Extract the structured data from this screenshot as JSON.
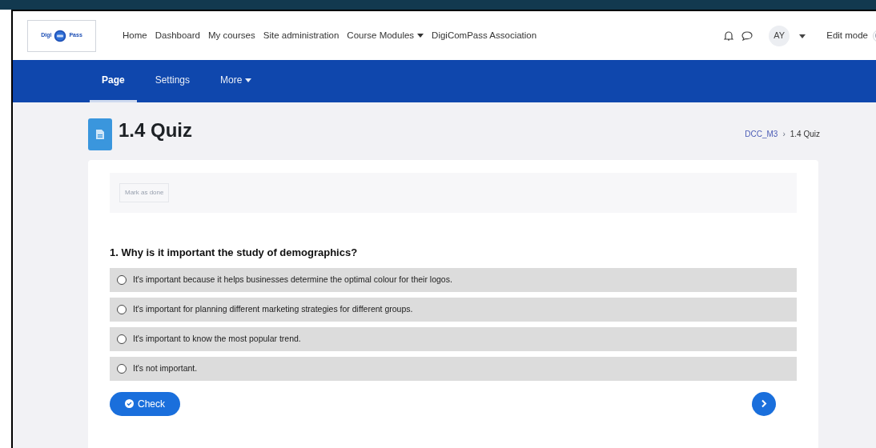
{
  "logo": {
    "left_text": "Digi",
    "right_text": "Pass"
  },
  "nav_links": [
    {
      "label": "Home",
      "dropdown": false
    },
    {
      "label": "Dashboard",
      "dropdown": false
    },
    {
      "label": "My courses",
      "dropdown": false
    },
    {
      "label": "Site administration",
      "dropdown": false
    },
    {
      "label": "Course Modules",
      "dropdown": true
    },
    {
      "label": "DigiComPass Association",
      "dropdown": false
    }
  ],
  "user": {
    "initials": "AY"
  },
  "edit_mode": {
    "label": "Edit mode",
    "on": false
  },
  "tabs": [
    {
      "label": "Page",
      "selected": true,
      "dropdown": false
    },
    {
      "label": "Settings",
      "selected": false,
      "dropdown": false
    },
    {
      "label": "More",
      "selected": false,
      "dropdown": true
    }
  ],
  "page_title": "1.4 Quiz",
  "breadcrumb": [
    "DCC_M3",
    "1.4 Quiz"
  ],
  "breadcrumb_separator": "›",
  "mark_done": {
    "label": "Mark as done",
    "done": false
  },
  "question": "1. Why is it important the study of demographics?",
  "options": [
    {
      "text": "It's important because it helps businesses determine the optimal colour for their logos.",
      "selected": false
    },
    {
      "text": "It's important for planning different marketing strategies for different groups.",
      "selected": false
    },
    {
      "text": "It's important to know the most popular trend.",
      "selected": false
    },
    {
      "text": "It's not important.",
      "selected": false
    }
  ],
  "check_button": "Check"
}
